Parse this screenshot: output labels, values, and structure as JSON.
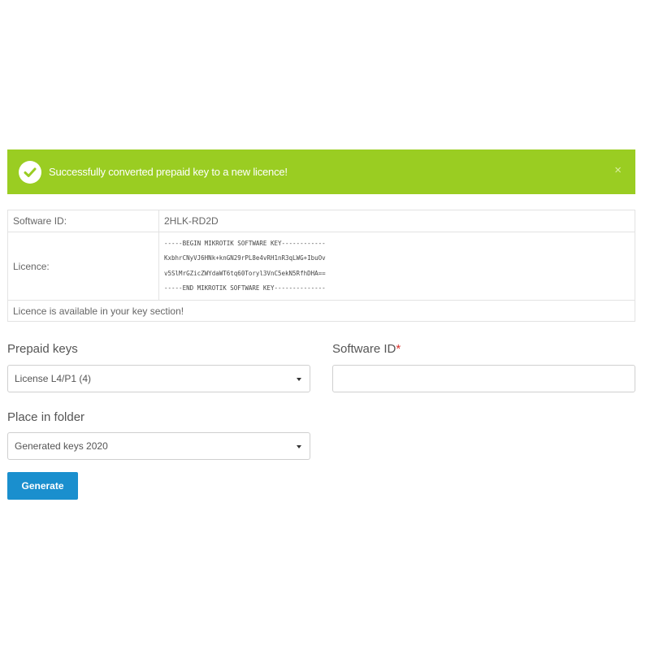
{
  "alert": {
    "message": "Successfully converted prepaid key to a new licence!",
    "close": "×",
    "icon": "check-circle-icon",
    "color": "#9acd22"
  },
  "info_table": {
    "software_id_label": "Software ID:",
    "software_id_value": "2HLK-RD2D",
    "licence_label": "Licence:",
    "licence_lines": [
      "-----BEGIN MIKROTIK SOFTWARE KEY------------",
      "KxbhrCNyVJ6HNk+knGN29rPL8e4vRH1nR3qLWG+IbuOv",
      "v5SlMrGZicZWYdaWT6tq60Toryl3VnC5ekN5RfhDHA==",
      "-----END MIKROTIK SOFTWARE KEY--------------"
    ],
    "footer_note": "Licence is available in your key section!"
  },
  "form": {
    "prepaid_keys_label": "Prepaid keys",
    "prepaid_keys_value": "License L4/P1 (4)",
    "software_id_label": "Software ID",
    "software_id_required": "*",
    "software_id_value": "",
    "folder_label": "Place in folder",
    "folder_value": "Generated keys 2020",
    "generate_label": "Generate",
    "button_color": "#1a8fce"
  }
}
